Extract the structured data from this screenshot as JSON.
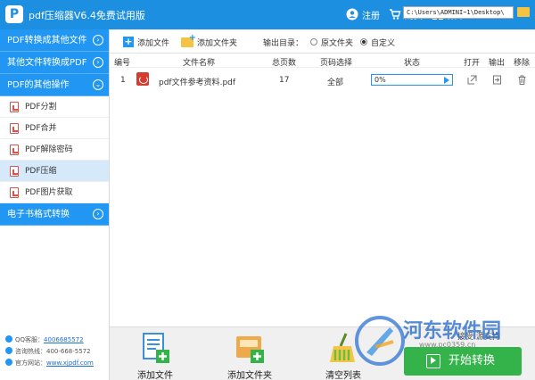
{
  "app": {
    "title": "pdf压缩器V6.4免费试用版"
  },
  "titlebar": {
    "register": "注册",
    "buy": "购买",
    "menu": "菜单"
  },
  "sidebar": {
    "categories": [
      {
        "label": "PDF转换成其他文件"
      },
      {
        "label": "其他文件转换成PDF"
      },
      {
        "label": "PDF的其他操作"
      },
      {
        "label": "电子书格式转换"
      }
    ],
    "sub_items": [
      {
        "label": "PDF分割"
      },
      {
        "label": "PDF合并"
      },
      {
        "label": "PDF解除密码"
      },
      {
        "label": "PDF压缩"
      },
      {
        "label": "PDF图片获取"
      }
    ],
    "active_item": "PDF压缩",
    "contacts": {
      "qq_label": "QQ客服：",
      "qq_value": "4006685572",
      "phone_label": "咨询热线：",
      "phone_value": "400-668-5572",
      "site_label": "官方网站：",
      "site_value": "www.xjpdf.com"
    }
  },
  "toolbar": {
    "add_file": "添加文件",
    "add_folder": "添加文件夹",
    "output_label": "输出目录：",
    "option_source": "原文件夹",
    "option_custom": "自定义",
    "selected_option": "自定义",
    "output_path": "C:\\Users\\ADMINI~1\\Desktop\\"
  },
  "table": {
    "headers": {
      "index": "编号",
      "name": "文件名称",
      "pages": "总页数",
      "range": "页码选择",
      "status": "状态",
      "open": "打开",
      "output": "输出",
      "remove": "移除"
    },
    "rows": [
      {
        "index": "1",
        "name": "pdf文件参考资料.pdf",
        "pages": "17",
        "range": "全部",
        "progress": "0%"
      }
    ]
  },
  "bottom": {
    "add_file": "添加文件",
    "add_folder": "添加文件夹",
    "clear_list": "清空列表",
    "hint": "接受 源支持",
    "start": "开始转换"
  },
  "watermark": {
    "text": "河东软件园",
    "url": "www.pc0359.cn"
  },
  "colors": {
    "primary": "#1d8fe0",
    "sidebar_category": "#2196f3",
    "start_button": "#33b34a",
    "active_row": "#d6e9fb"
  }
}
